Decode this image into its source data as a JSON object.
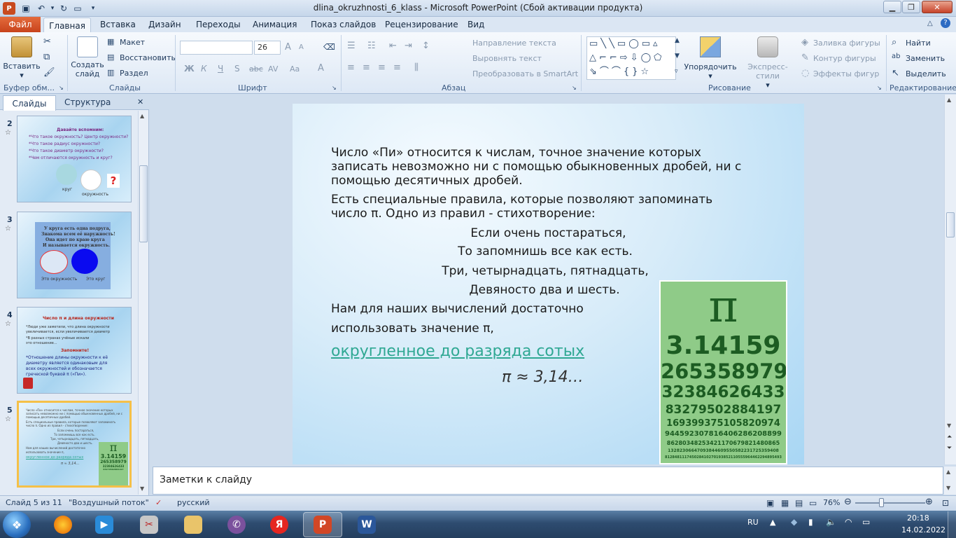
{
  "window": {
    "title": "dlina_okruzhnosti_6_klass  -  Microsoft PowerPoint (Сбой активации продукта)"
  },
  "tabs": {
    "file": "Файл",
    "home": "Главная",
    "insert": "Вставка",
    "design": "Дизайн",
    "transitions": "Переходы",
    "animation": "Анимация",
    "slideshow": "Показ слайдов",
    "review": "Рецензирование",
    "view": "Вид"
  },
  "ribbon": {
    "clipboard": {
      "label": "Буфер обм...",
      "paste": "Вставить"
    },
    "slides": {
      "label": "Слайды",
      "new_slide_1": "Создать",
      "new_slide_2": "слайд",
      "layout": "Макет",
      "reset": "Восстановить",
      "section": "Раздел"
    },
    "font": {
      "label": "Шрифт",
      "name": "",
      "size": "26",
      "bold": "Ж",
      "italic": "К",
      "underline": "Ч",
      "strike": "abc",
      "shadow": "S",
      "spacing": "AV",
      "case": "Aa",
      "color": "A",
      "grow": "A",
      "shrink": "A"
    },
    "paragraph": {
      "label": "Абзац",
      "text_direction": "Направление текста",
      "align_text": "Выровнять текст",
      "smartart": "Преобразовать в SmartArt"
    },
    "drawing": {
      "label": "Рисование",
      "arrange": "Упорядочить",
      "quick_styles": "Экспресс-стили",
      "fill": "Заливка фигуры",
      "outline": "Контур фигуры",
      "effects": "Эффекты фигур"
    },
    "editing": {
      "label": "Редактирование",
      "find": "Найти",
      "replace": "Заменить",
      "select": "Выделить"
    }
  },
  "left_pane": {
    "tab_slides": "Слайды",
    "tab_outline": "Структура",
    "close": "✕"
  },
  "thumbnails": [
    {
      "num": "2",
      "lines": [
        "Давайте вспомним:",
        "*Что такое окружность? Центр окружности?",
        "*Что такое радиус окружности?",
        "*Что такое диаметр окружности?",
        "*Чем отличаются окружность и круг?"
      ],
      "label_circle": "круг",
      "label_ring": "окружность",
      "question": "?"
    },
    {
      "num": "3",
      "lines": [
        "У круга есть одна подруга,",
        "Знакома всем её наружность!",
        "Она идет по краю круга",
        "И называется окружность."
      ],
      "label_left": "Это окружность",
      "label_right": "Это круг"
    },
    {
      "num": "4",
      "title": "Число π и длина окружности",
      "lines": [
        "*Люди уже заметили, что длина окружности",
        "  увеличивается, если увеличивается диаметр",
        "*В разных странах учёные искали",
        "  это отношение..."
      ],
      "remember": "Запомните!",
      "rule": [
        "*Отношение длины окружности к её",
        "  диаметру является одинаковым для",
        "  всех окружностей и обозначается",
        "  греческой буквой π («Пи»)."
      ]
    },
    {
      "num": "5",
      "pi": "π",
      "pi_value": "3.14159",
      "pi_digits": "265358979"
    }
  ],
  "slide": {
    "p1": [
      "Число «Пи» относится к числам, точное значение которых",
      "записать невозможно ни с помощью обыкновенных дробей, ни с",
      "помощью десятичных дробей."
    ],
    "p2": [
      "Есть специальные правила, которые позволяют запоминать",
      "число  π. Одно из правил - стихотворение:"
    ],
    "poem": [
      "Если очень постараться,",
      "То запомнишь все как есть.",
      "Три, четырнадцать, пятнадцать,",
      "Девяносто два и шесть."
    ],
    "p3": [
      " Нам для наших вычислений достаточно",
      "использовать значение π,"
    ],
    "link": "округленное до разряда сотых",
    "approx": "π ≈ 3,14…",
    "pi_symbol": "π",
    "pi_rows": [
      "3.14159",
      "265358979",
      "32384626433",
      "83279502884197",
      "169399375105820974",
      "944592307816406286208899",
      "86280348253421170679821480865",
      "13282306647093844609550582231725359408",
      "812848111745028410270193852110555964462294895493"
    ]
  },
  "notes_placeholder": "Заметки к слайду",
  "status": {
    "slide": "Слайд 5 из 11",
    "theme": "\"Воздушный поток\"",
    "lang": "русский",
    "zoom": "76%"
  },
  "clock": {
    "time": "20:18",
    "date": "14.02.2022"
  },
  "colors": {
    "accent": "#c8431c",
    "link": "#2fa893",
    "pi_green": "#8fcb88"
  }
}
